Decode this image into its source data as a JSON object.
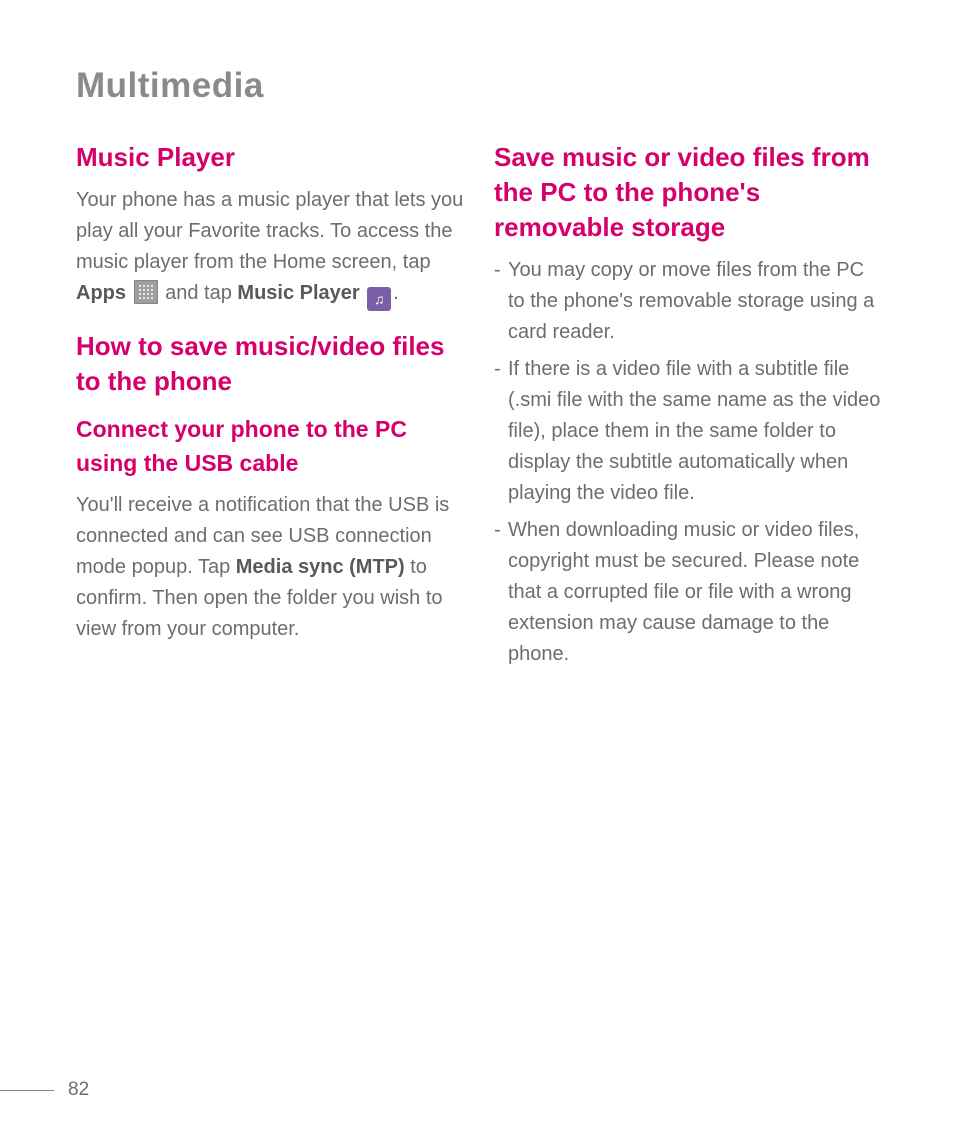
{
  "page_title": "Multimedia",
  "page_number": "82",
  "left": {
    "h_music": "Music Player",
    "p_music_1": "Your phone has a music player that lets you play all your Favorite tracks. To access the music player from the Home screen, tap ",
    "p_music_apps": "Apps",
    "p_music_2": " and tap ",
    "p_music_mp": "Music Player",
    "p_music_3": ".",
    "h_save": "How to save music/video files to the phone",
    "h_connect": "Connect your phone to the PC using the USB cable",
    "p_connect_1": "You'll receive a notification that the USB is connected and can see USB connection mode popup. Tap ",
    "p_connect_bold": "Media sync (MTP)",
    "p_connect_2": " to confirm. Then open the folder you wish to view from your computer."
  },
  "right": {
    "h_save_pc": "Save music or video files from the PC to the phone's removable storage",
    "items": [
      "You may copy or move files from the PC to the phone's removable storage using a card reader.",
      "If there is a video file with a subtitle file (.smi file with the same name as the video file), place them in the same folder to display the subtitle automatically when playing the video file.",
      "When downloading music or video files, copyright must be secured. Please note that a corrupted file or file with a wrong extension may cause damage to the phone."
    ]
  }
}
